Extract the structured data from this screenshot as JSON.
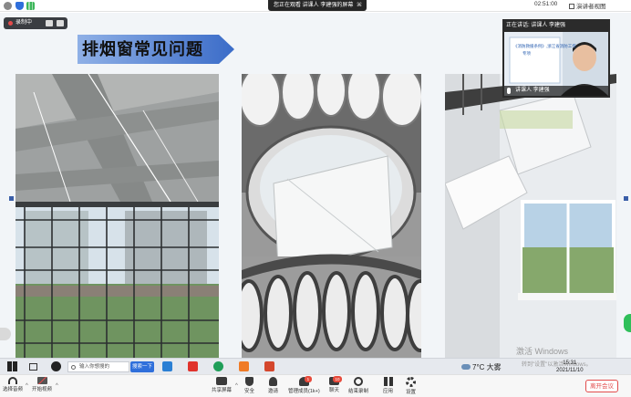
{
  "top_bar": {
    "sharing_notice": "您正在观看 讲课人  李建强的屏幕",
    "close_glyph": "⌘",
    "timer": "02:51:00",
    "view_button": "演讲者视图"
  },
  "recording": {
    "label": "录制中"
  },
  "slide": {
    "title": "排烟窗常见问题"
  },
  "webcam": {
    "header": "正在讲话:  讲课人  李建强",
    "screen_line1": "《消防救援条例》,浙江省消防工作",
    "screen_line2": "专项",
    "participant_label": "讲课人  李建强"
  },
  "watermark": {
    "activate_windows": "激活 Windows"
  },
  "taskbar": {
    "search_placeholder": "输入你想搜的",
    "search_button": "搜索一下",
    "weather": "7°C  大雾",
    "activate_text": "转到\"设置\"以激活Windows。",
    "time": "15:31",
    "date": "2021/11/10"
  },
  "toolbar": {
    "unmute_label": "选择音频",
    "video_label": "开始视频",
    "share_label": "共享屏幕",
    "security_label": "安全",
    "invite_label": "邀请",
    "participants_label": "管理成员(1k+)",
    "participants_badge": "1",
    "chat_label": "聊天",
    "chat_badge": "10",
    "record_label": "结束录制",
    "apps_label": "应用",
    "settings_label": "设置",
    "leave_label": "离开会议"
  },
  "colors": {
    "accent": "#2f6fdb",
    "leave": "#e24c4c",
    "banner": "#2c5db0",
    "record": "#e34b4b"
  }
}
